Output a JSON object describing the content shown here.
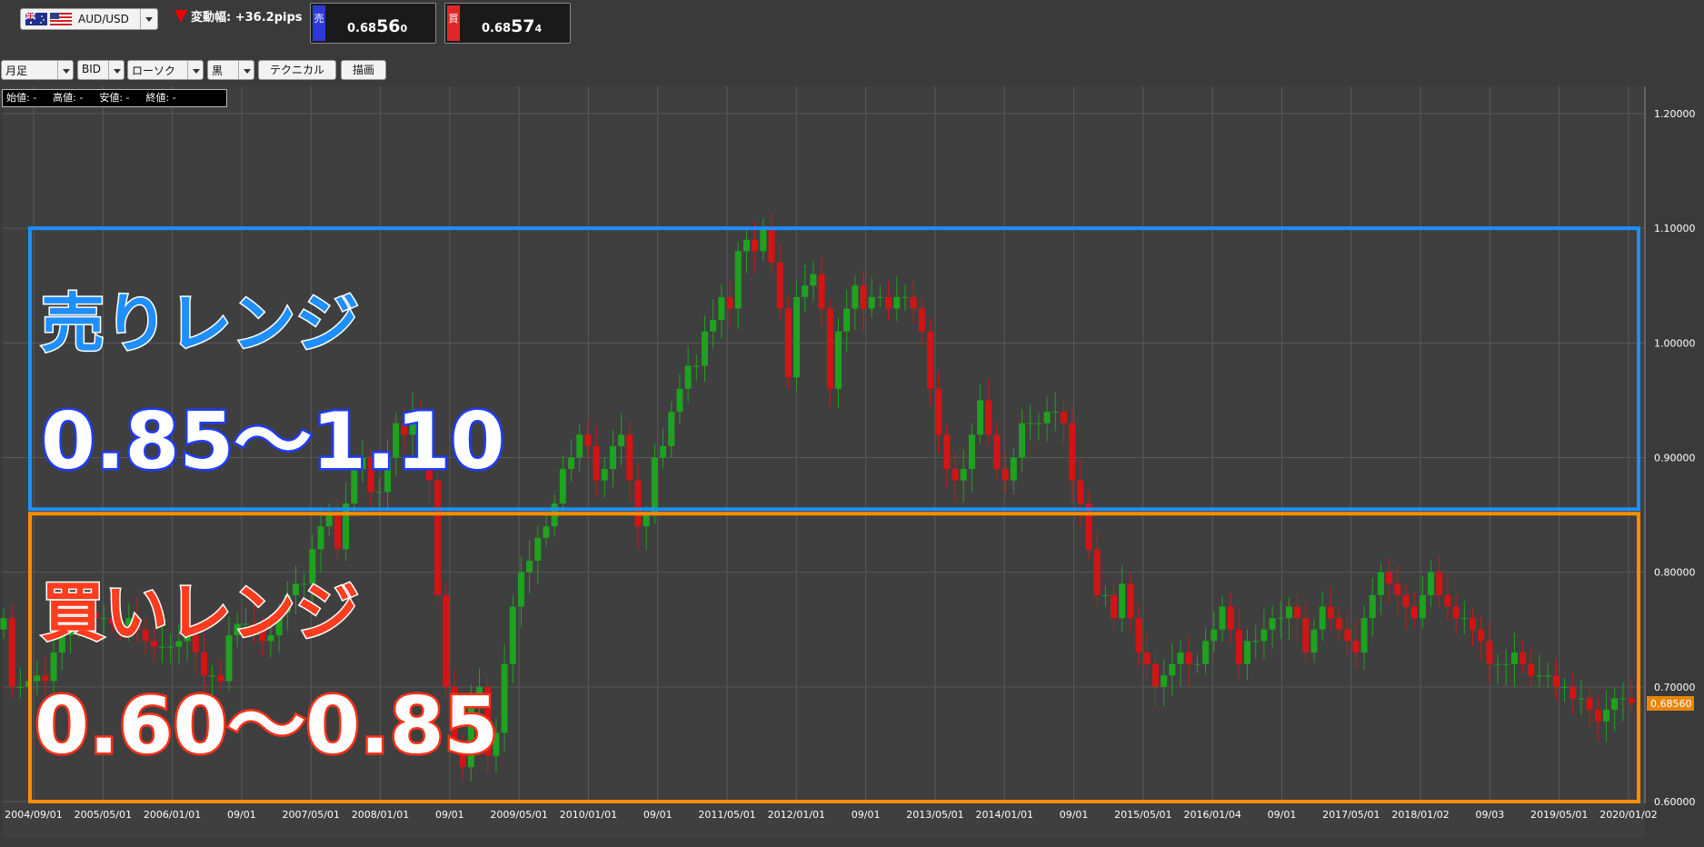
{
  "header": {
    "pair_label": "AUD/USD",
    "change_text": "変動幅: +36.2pips",
    "sell": {
      "tag": "売",
      "price_prefix": "0.68",
      "price_main": "56",
      "price_suffix": "0"
    },
    "buy": {
      "tag": "買",
      "price_prefix": "0.68",
      "price_main": "57",
      "price_suffix": "4"
    }
  },
  "toolbar": {
    "period": "月足",
    "price_type": "BID",
    "chart_type": "ローソク",
    "color": "黒",
    "technical_button": "テクニカル",
    "draw_button": "描画"
  },
  "ohlc": {
    "open": "始値: -",
    "high": "高値: -",
    "low": "安値: -",
    "close": "終値: -"
  },
  "annotations": {
    "sell_title": "売りレンジ",
    "sell_range": "0.85～1.10",
    "buy_title": "買いレンジ",
    "buy_range": "0.60～0.85"
  },
  "colors": {
    "up": "#1fa21f",
    "down": "#d41414",
    "sell_box": "#1e8fff",
    "buy_box": "#ff8c00",
    "current_price_tag": "#e8860c"
  },
  "chart_data": {
    "type": "candlestick",
    "title": "",
    "ylim": [
      0.6,
      1.2
    ],
    "y_ticks": [
      "1.20000",
      "1.10000",
      "1.00000",
      "0.90000",
      "0.80000",
      "0.70000",
      "0.60000"
    ],
    "x_ticks": [
      "2004/09/01",
      "2005/05/01",
      "2006/01/01",
      "09/01",
      "2007/05/01",
      "2008/01/01",
      "09/01",
      "2009/05/01",
      "2010/01/01",
      "09/01",
      "2011/05/01",
      "2012/01/01",
      "09/01",
      "2013/05/01",
      "2014/01/01",
      "09/01",
      "2015/05/01",
      "2016/01/04",
      "09/01",
      "2017/05/01",
      "2018/01/02",
      "09/03",
      "2019/05/01",
      "2020/01/02"
    ],
    "current_price": "0.68560",
    "sell_range": [
      0.855,
      1.1
    ],
    "buy_range": [
      0.6,
      0.855
    ],
    "closes": [
      0.76,
      0.7,
      0.7,
      0.705,
      0.71,
      0.705,
      0.73,
      0.745,
      0.76,
      0.76,
      0.765,
      0.76,
      0.76,
      0.755,
      0.75,
      0.76,
      0.75,
      0.74,
      0.735,
      0.735,
      0.735,
      0.74,
      0.745,
      0.73,
      0.71,
      0.71,
      0.705,
      0.745,
      0.755,
      0.755,
      0.75,
      0.74,
      0.745,
      0.765,
      0.78,
      0.79,
      0.79,
      0.82,
      0.84,
      0.85,
      0.82,
      0.86,
      0.89,
      0.9,
      0.87,
      0.87,
      0.9,
      0.93,
      0.92,
      0.94,
      0.92,
      0.88,
      0.78,
      0.7,
      0.65,
      0.63,
      0.69,
      0.7,
      0.64,
      0.66,
      0.72,
      0.77,
      0.8,
      0.81,
      0.83,
      0.84,
      0.86,
      0.89,
      0.9,
      0.92,
      0.91,
      0.88,
      0.89,
      0.91,
      0.92,
      0.88,
      0.84,
      0.85,
      0.9,
      0.91,
      0.94,
      0.96,
      0.98,
      0.98,
      1.01,
      1.02,
      1.04,
      1.03,
      1.08,
      1.09,
      1.08,
      1.1,
      1.07,
      1.03,
      0.97,
      1.04,
      1.05,
      1.06,
      1.03,
      0.96,
      1.01,
      1.03,
      1.05,
      1.03,
      1.04,
      1.04,
      1.03,
      1.04,
      1.04,
      1.03,
      1.01,
      0.96,
      0.92,
      0.89,
      0.88,
      0.89,
      0.92,
      0.95,
      0.92,
      0.89,
      0.88,
      0.9,
      0.93,
      0.93,
      0.93,
      0.94,
      0.94,
      0.93,
      0.88,
      0.86,
      0.82,
      0.78,
      0.78,
      0.76,
      0.79,
      0.76,
      0.73,
      0.72,
      0.7,
      0.71,
      0.72,
      0.73,
      0.72,
      0.72,
      0.74,
      0.75,
      0.77,
      0.75,
      0.72,
      0.74,
      0.74,
      0.75,
      0.76,
      0.76,
      0.77,
      0.76,
      0.73,
      0.75,
      0.77,
      0.76,
      0.75,
      0.74,
      0.73,
      0.76,
      0.78,
      0.8,
      0.79,
      0.78,
      0.77,
      0.76,
      0.78,
      0.8,
      0.78,
      0.77,
      0.76,
      0.76,
      0.75,
      0.74,
      0.72,
      0.72,
      0.72,
      0.73,
      0.72,
      0.71,
      0.71,
      0.71,
      0.7,
      0.7,
      0.69,
      0.69,
      0.68,
      0.67,
      0.68,
      0.69,
      0.69,
      0.686
    ]
  }
}
